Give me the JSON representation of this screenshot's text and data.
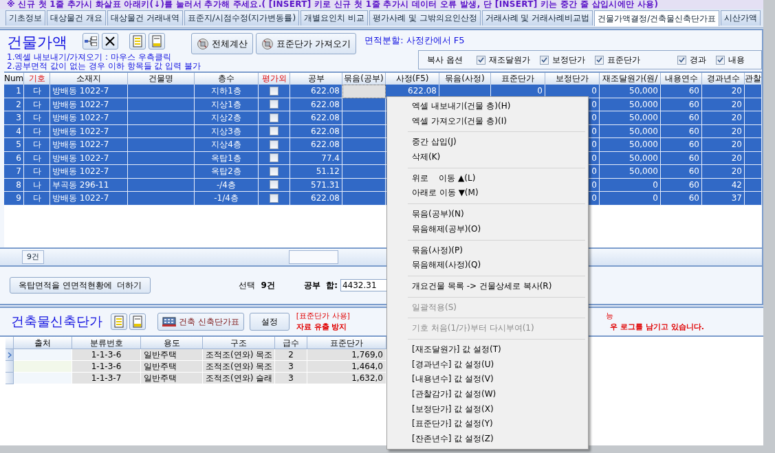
{
  "notice": "※ 신규 첫 1줄 추가시 화살표 아래키(↓)를 눌러서 추가해 주세요.( [INSERT] 키로 신규 첫 1줄 추가시 데이터 오류 발생, 단 [INSERT] 키는 중간 줄 삽입시에만 사용)",
  "tabs": [
    {
      "label": "기초정보",
      "selected": false
    },
    {
      "label": "대상물건 개요",
      "selected": false
    },
    {
      "label": "대상물건 거래내역",
      "selected": false
    },
    {
      "label": "표준지/시점수정(지가변동률)",
      "selected": false
    },
    {
      "label": "개별요인치 비교",
      "selected": false
    },
    {
      "label": "평가사례 및 그밖의요인산정",
      "selected": false
    },
    {
      "label": "거래사례 및 거래사례비교법",
      "selected": false
    },
    {
      "label": "건물가액결정/건축물신축단가표",
      "selected": true
    },
    {
      "label": "시산가액",
      "selected": false
    }
  ],
  "building": {
    "title": "건물가액",
    "buttons": [
      "전체계산",
      "표준단가 가져오기"
    ],
    "split_hint": "면적분할: 사정칸에서 F5",
    "notes": [
      "1.엑셀 내보내기/가져오기 : 마우스 우측클릭",
      "2.공부면적 값이 없는 경우 이하 항목들 값 입력 불가"
    ],
    "copy_options": {
      "label": "복사 옵션",
      "options": [
        {
          "label": "재조달원가",
          "checked": true
        },
        {
          "label": "보정단가",
          "checked": true
        },
        {
          "label": "표준단가",
          "checked": true
        },
        {
          "label": "경과",
          "checked": true
        },
        {
          "label": "내용",
          "checked": true
        }
      ]
    },
    "table": {
      "columns": [
        {
          "label": "Num",
          "highlight": false
        },
        {
          "label": "기호",
          "highlight": true
        },
        {
          "label": "소재지",
          "highlight": false
        },
        {
          "label": "건물명",
          "highlight": false
        },
        {
          "label": "층수",
          "highlight": false
        },
        {
          "label": "평가외",
          "highlight": true,
          "kind": "checkbox"
        },
        {
          "label": "공부",
          "highlight": false
        },
        {
          "label": "묶음(공부)",
          "highlight": false
        },
        {
          "label": "사정(F5)",
          "highlight": false
        },
        {
          "label": "묶음(사정)",
          "highlight": false
        },
        {
          "label": "표준단가",
          "highlight": false
        },
        {
          "label": "보정단가",
          "highlight": false
        },
        {
          "label": "재조달원가(원/",
          "highlight": false
        },
        {
          "label": "내용연수",
          "highlight": false
        },
        {
          "label": "경과년수",
          "highlight": false
        },
        {
          "label": "관찰",
          "highlight": false
        }
      ],
      "rows": [
        {
          "selected": true,
          "current": true,
          "excluded": false,
          "cells": [
            "1",
            "다",
            "방배동 1022-7",
            null,
            "지하1층",
            null,
            "622.08",
            null,
            "622.08",
            null,
            "0",
            "0",
            "50,000",
            "60",
            "20",
            null
          ]
        },
        {
          "selected": true,
          "current": false,
          "excluded": false,
          "cells": [
            "2",
            "다",
            "방배동 1022-7",
            null,
            "지상1층",
            null,
            "622.08",
            null,
            null,
            null,
            null,
            "0",
            "50,000",
            "60",
            "20",
            null
          ]
        },
        {
          "selected": true,
          "current": false,
          "excluded": false,
          "cells": [
            "3",
            "다",
            "방배동 1022-7",
            null,
            "지상2층",
            null,
            "622.08",
            null,
            null,
            null,
            null,
            "0",
            "50,000",
            "60",
            "20",
            null
          ]
        },
        {
          "selected": true,
          "current": false,
          "excluded": false,
          "cells": [
            "4",
            "다",
            "방배동 1022-7",
            null,
            "지상3층",
            null,
            "622.08",
            null,
            null,
            null,
            null,
            "0",
            "50,000",
            "60",
            "20",
            null
          ]
        },
        {
          "selected": true,
          "current": false,
          "excluded": false,
          "cells": [
            "5",
            "다",
            "방배동 1022-7",
            null,
            "지상4층",
            null,
            "622.08",
            null,
            null,
            null,
            null,
            "0",
            "50,000",
            "60",
            "20",
            null
          ]
        },
        {
          "selected": true,
          "current": false,
          "excluded": false,
          "cells": [
            "6",
            "다",
            "방배동 1022-7",
            null,
            "옥탑1층",
            null,
            "77.4",
            null,
            null,
            null,
            null,
            "0",
            "50,000",
            "60",
            "20",
            null
          ]
        },
        {
          "selected": true,
          "current": false,
          "excluded": false,
          "cells": [
            "7",
            "다",
            "방배동 1022-7",
            null,
            "옥탑2층",
            null,
            "51.12",
            null,
            null,
            null,
            null,
            "0",
            "50,000",
            "60",
            "20",
            null
          ]
        },
        {
          "selected": true,
          "current": false,
          "excluded": false,
          "cells": [
            "8",
            "나",
            "부곡동 296-11",
            null,
            "-/4층",
            null,
            "571.31",
            null,
            null,
            null,
            null,
            "0",
            "0",
            "60",
            "42",
            null
          ]
        },
        {
          "selected": true,
          "current": false,
          "excluded": false,
          "cells": [
            "9",
            "다",
            "방배동 1022-7",
            null,
            "-1/4층",
            null,
            "622.08",
            null,
            null,
            null,
            null,
            "0",
            "0",
            "60",
            "37",
            null
          ]
        }
      ],
      "row_count": "9건"
    }
  },
  "summary": {
    "button": "옥탑면적을 연면적현황에  더하기",
    "selection_label": "선택",
    "selection_count": "9건",
    "sum_label": "공부  합:",
    "sum_value": "4432.31"
  },
  "unit_price": {
    "title": "건축물신축단가",
    "table_button": "건축 신축단가표",
    "settings_button": "설정",
    "warnings": [
      {
        "left": "[표준단가 사용]",
        "right": "능",
        "strong": false
      },
      {
        "left": "자료 유출 방지",
        "right": "우 로그를 남기고 있습니다.",
        "strong": true
      }
    ],
    "table": {
      "columns": [
        "출처",
        "분류번호",
        "용도",
        "구조",
        "급수",
        "표준단가"
      ],
      "rows": [
        {
          "current": true,
          "cells": [
            null,
            "1-1-3-6",
            "일반주택",
            "조적조(연와) 목조",
            "2",
            "1,769,0"
          ]
        },
        {
          "current": false,
          "cells": [
            null,
            "1-1-3-6",
            "일반주택",
            "조적조(연와) 목조",
            "3",
            "1,464,0"
          ]
        },
        {
          "current": false,
          "cells": [
            null,
            "1-1-3-7",
            "일반주택",
            "조적조(연와) 슬래",
            "3",
            "1,632,0"
          ]
        }
      ]
    }
  },
  "context_menu": [
    {
      "kind": "item",
      "label": "엑셀 내보내기(건물 층)(H)",
      "disabled": false
    },
    {
      "kind": "item",
      "label": "엑셀 가져오기(건물 층)(I)",
      "disabled": false
    },
    {
      "kind": "separator"
    },
    {
      "kind": "item",
      "label": "중간 삽입(J)",
      "disabled": false
    },
    {
      "kind": "item",
      "label": "삭제(K)",
      "disabled": false
    },
    {
      "kind": "separator"
    },
    {
      "kind": "item",
      "label": "위로    이동 ▲(L)",
      "disabled": false
    },
    {
      "kind": "item",
      "label": "아래로 이동 ▼(M)",
      "disabled": false
    },
    {
      "kind": "separator"
    },
    {
      "kind": "item",
      "label": "묶음(공부)(N)",
      "disabled": false
    },
    {
      "kind": "item",
      "label": "묶음해제(공부)(O)",
      "disabled": false
    },
    {
      "kind": "separator"
    },
    {
      "kind": "item",
      "label": "묶음(사정)(P)",
      "disabled": false
    },
    {
      "kind": "item",
      "label": "묶음해제(사정)(Q)",
      "disabled": false
    },
    {
      "kind": "separator"
    },
    {
      "kind": "item",
      "label": "개요건물 목록 -> 건물상세로 복사(R)",
      "disabled": false
    },
    {
      "kind": "separator"
    },
    {
      "kind": "item",
      "label": "일괄적용(S)",
      "disabled": true
    },
    {
      "kind": "separator"
    },
    {
      "kind": "item",
      "label": "기호 처음(1/가)부터 다시부여(1)",
      "disabled": true
    },
    {
      "kind": "separator"
    },
    {
      "kind": "item",
      "label": "[재조달원가] 값 설정(T)",
      "disabled": false
    },
    {
      "kind": "item",
      "label": "[경과년수] 값 설정(U)",
      "disabled": false
    },
    {
      "kind": "item",
      "label": "[내용년수] 값 설정(V)",
      "disabled": false
    },
    {
      "kind": "item",
      "label": "[관찰감가] 값 설정(W)",
      "disabled": false
    },
    {
      "kind": "item",
      "label": "[보정단가] 값 설정(X)",
      "disabled": false
    },
    {
      "kind": "item",
      "label": "[표준단가] 값 설정(Y)",
      "disabled": false
    },
    {
      "kind": "item",
      "label": "[잔존년수] 값 설정(Z)",
      "disabled": false
    }
  ]
}
